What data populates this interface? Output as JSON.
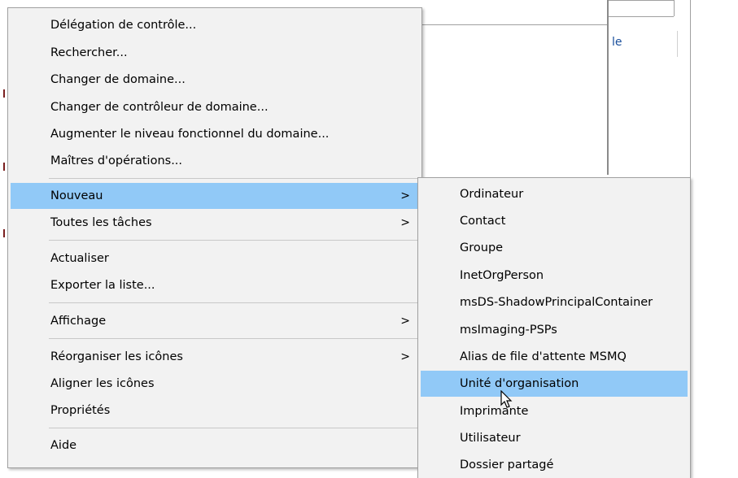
{
  "background": {
    "fragment_text": "le"
  },
  "context_menu": {
    "items": [
      {
        "label": "Délégation de contrôle..."
      },
      {
        "label": "Rechercher..."
      },
      {
        "label": "Changer de domaine..."
      },
      {
        "label": "Changer de contrôleur de domaine..."
      },
      {
        "label": "Augmenter le niveau fonctionnel du domaine..."
      },
      {
        "label": "Maîtres d'opérations..."
      },
      {
        "label": "Nouveau",
        "arrow": ">"
      },
      {
        "label": "Toutes les tâches",
        "arrow": ">"
      },
      {
        "label": "Actualiser"
      },
      {
        "label": "Exporter la liste..."
      },
      {
        "label": "Affichage",
        "arrow": ">"
      },
      {
        "label": "Réorganiser les icônes",
        "arrow": ">"
      },
      {
        "label": "Aligner les icônes"
      },
      {
        "label": "Propriétés"
      },
      {
        "label": "Aide"
      }
    ],
    "highlight_color": "#91c9f7",
    "background_color": "#f2f2f2"
  },
  "submenu": {
    "items": [
      {
        "label": "Ordinateur"
      },
      {
        "label": "Contact"
      },
      {
        "label": "Groupe"
      },
      {
        "label": "InetOrgPerson"
      },
      {
        "label": "msDS-ShadowPrincipalContainer"
      },
      {
        "label": "msImaging-PSPs"
      },
      {
        "label": "Alias de file d'attente MSMQ"
      },
      {
        "label": "Unité d'organisation"
      },
      {
        "label": "Imprimante"
      },
      {
        "label": "Utilisateur"
      },
      {
        "label": "Dossier partagé"
      }
    ]
  }
}
